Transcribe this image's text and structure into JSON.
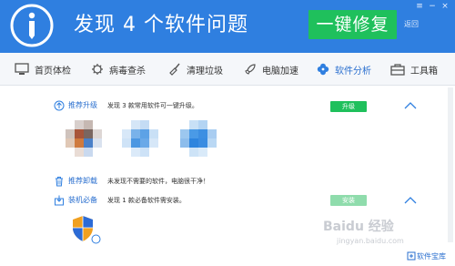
{
  "header": {
    "headline": "发现 4 个软件问题",
    "fix_button": "一键修复",
    "back_link": "返回",
    "menu_glyph": "≡",
    "minimize_glyph": "−",
    "close_glyph": "×",
    "background": "#2f7fe0"
  },
  "tabs": [
    {
      "label": "首页体检",
      "icon": "monitor-icon"
    },
    {
      "label": "病毒查杀",
      "icon": "virus-icon"
    },
    {
      "label": "清理垃圾",
      "icon": "broom-icon"
    },
    {
      "label": "电脑加速",
      "icon": "rocket-icon"
    },
    {
      "label": "软件分析",
      "icon": "clover-icon",
      "active": true
    },
    {
      "label": "工具箱",
      "icon": "toolbox-icon"
    }
  ],
  "sections": {
    "upgrade": {
      "title": "推荐升级",
      "desc": "发现 3 款常用软件可一键升级。",
      "button": "升级"
    },
    "uninstall": {
      "title": "推荐卸载",
      "desc": "未发现不需要的软件，电脑很干净！"
    },
    "essential": {
      "title": "装机必备",
      "desc": "发现 1 款必备软件需安装。",
      "button": "安装"
    }
  },
  "footer": {
    "link": "软件宝库"
  },
  "watermark": {
    "main": "Baidu 经验",
    "sub": "jingyan.baidu.com"
  },
  "colors": {
    "accent": "#2f7fe0",
    "action_green": "#1fc05c",
    "link_blue": "#2a6fcf"
  }
}
